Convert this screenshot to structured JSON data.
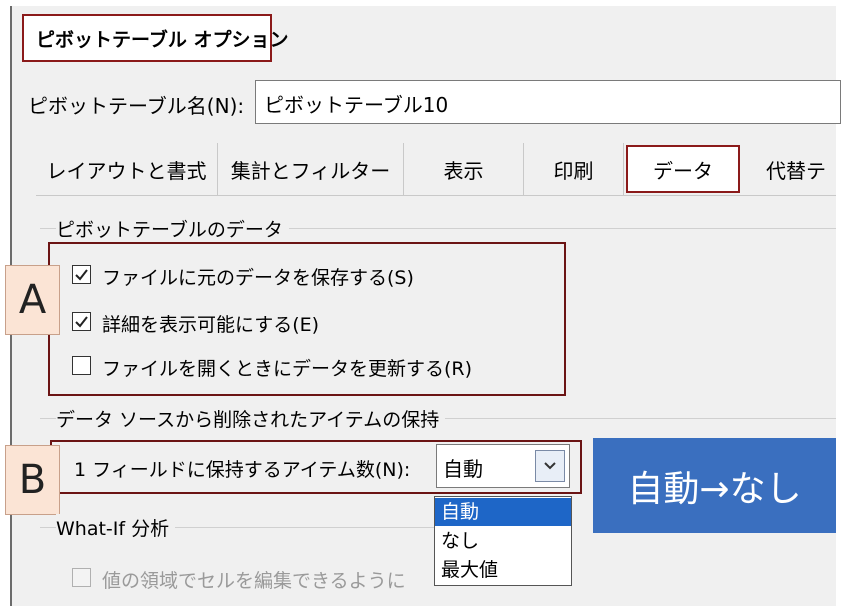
{
  "dialog": {
    "title": "ピボットテーブル オプション",
    "name_label": "ピボットテーブル名(N):",
    "name_value": "ピボットテーブル10"
  },
  "tabs": [
    {
      "label": "レイアウトと書式"
    },
    {
      "label": "集計とフィルター"
    },
    {
      "label": "表示"
    },
    {
      "label": "印刷"
    },
    {
      "label": "データ",
      "active": true
    },
    {
      "label": "代替テ"
    }
  ],
  "pivot_data_group": {
    "label": "ピボットテーブルのデータ",
    "items": [
      {
        "label": "ファイルに元のデータを保存する(S)",
        "checked": true
      },
      {
        "label": "詳細を表示可能にする(E)",
        "checked": true
      },
      {
        "label": "ファイルを開くときにデータを更新する(R)",
        "checked": false
      }
    ]
  },
  "retain_group": {
    "label": "データ ソースから削除されたアイテムの保持",
    "field_label": "1 フィールドに保持するアイテム数(N):",
    "selected": "自動",
    "options": [
      "自動",
      "なし",
      "最大値"
    ]
  },
  "whatif_group": {
    "label": "What-If 分析",
    "item_label": "値の領域でセルを編集できるように"
  },
  "callouts": {
    "a": "A",
    "b": "B"
  },
  "banner": {
    "text": "自動→なし"
  },
  "colors": {
    "highlight_border": "#8b1a1a",
    "banner_bg": "#3a6fbf",
    "selected_option": "#1e66c7",
    "callout_bg": "#fbe4d5"
  }
}
